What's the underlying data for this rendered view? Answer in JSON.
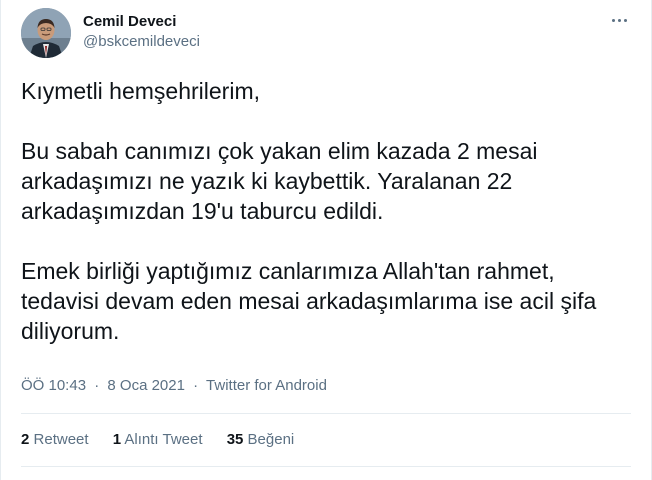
{
  "author": {
    "display_name": "Cemil Deveci",
    "handle": "@bskcemildeveci",
    "avatar_icon": "profile-photo"
  },
  "more_icon": "more-dots-icon",
  "tweet": {
    "paragraphs": [
      [
        "Kıymetli hemşehrilerim,"
      ],
      [
        "Bu sabah canımızı çok yakan elim kazada 2 mesai",
        "arkadaşımızı ne yazık ki kaybettik. Yaralanan 22",
        "arkadaşımızdan 19'u taburcu edildi."
      ],
      [
        "Emek birliği yaptığımız canlarımıza Allah'tan rahmet,",
        "tedavisi devam eden mesai arkadaşımlarıma ise acil şifa",
        "diliyorum."
      ]
    ]
  },
  "meta": {
    "time": "ÖÖ 10:43",
    "separator": "·",
    "date": "8 Oca 2021",
    "source": "Twitter for Android"
  },
  "stats": {
    "retweets_count": "2",
    "retweets_label": "Retweet",
    "quotes_count": "1",
    "quotes_label": "Alıntı Tweet",
    "likes_count": "35",
    "likes_label": "Beğeni"
  },
  "colors": {
    "text": "#0f1419",
    "secondary": "#5b7083",
    "divider": "#e6ecf0"
  }
}
